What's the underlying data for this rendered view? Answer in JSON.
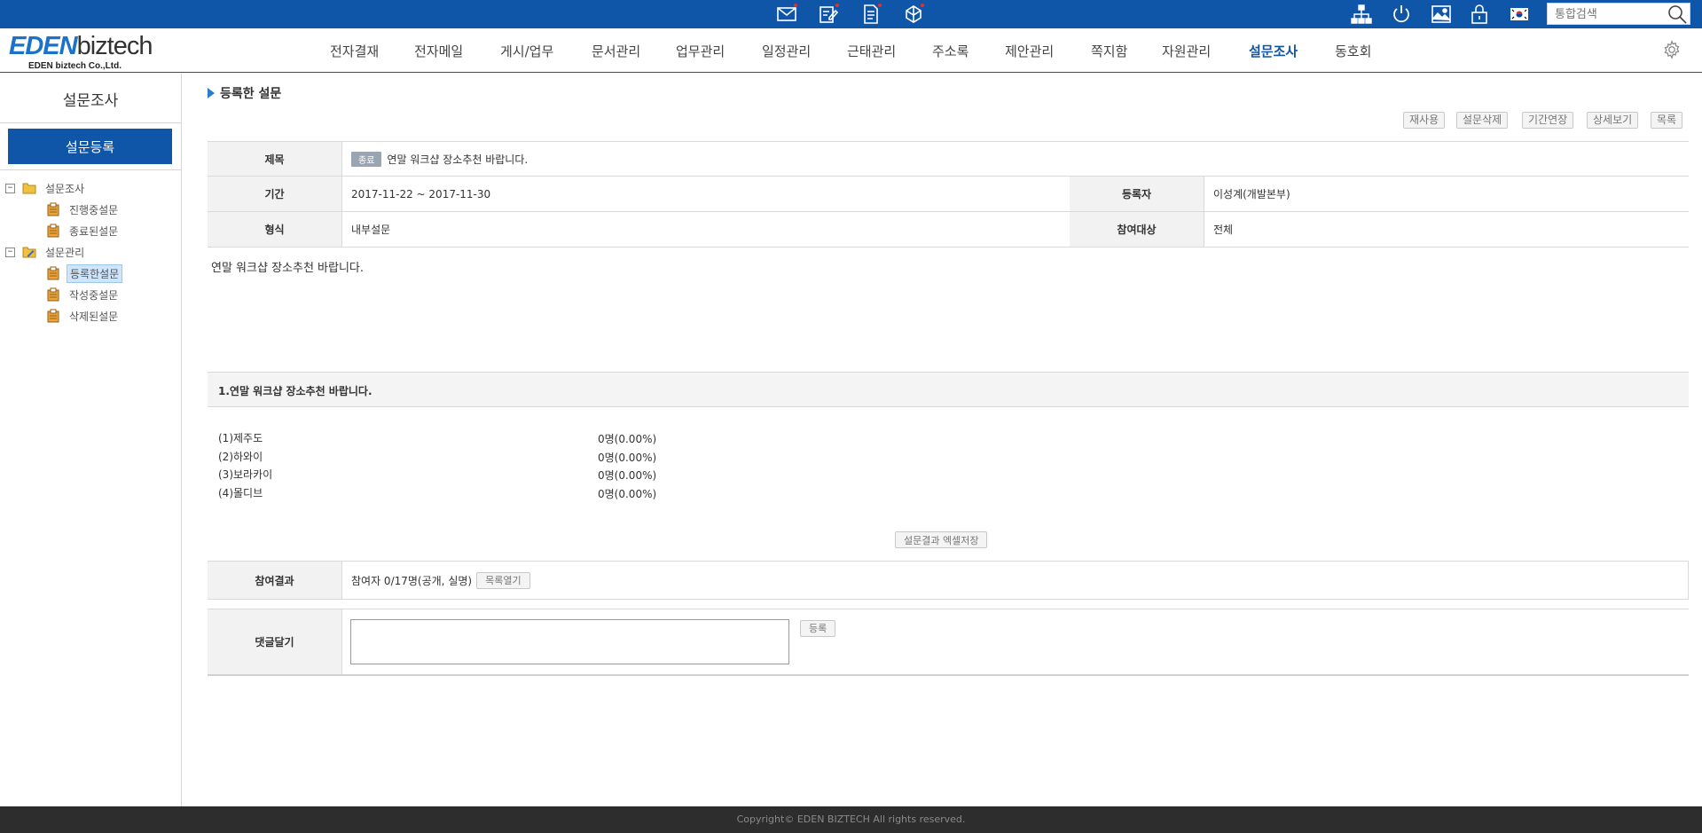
{
  "topbar": {
    "icons": [
      "mail-icon",
      "approval-icon",
      "document-icon",
      "notebook-icon",
      "org-chart-icon",
      "power-icon",
      "image-icon",
      "lock-icon",
      "korea-flag-icon"
    ],
    "search_placeholder": "통합검색",
    "accent": "#0f56a8"
  },
  "header": {
    "logo_brand_a": "EDEN",
    "logo_brand_b": "biztech",
    "logo_sub": "EDEN biztech Co.,Ltd.",
    "nav": [
      "전자결재",
      "전자메일",
      "게시/업무",
      "문서관리",
      "업무관리",
      "일정관리",
      "근태관리",
      "주소록",
      "제안관리",
      "쪽지함",
      "자원관리",
      "설문조사",
      "동호회"
    ],
    "active_nav": "설문조사"
  },
  "sidebar": {
    "title": "설문조사",
    "register_button": "설문등록",
    "tree": [
      {
        "label": "설문조사",
        "toggle": "−",
        "children": [
          "진행중설문",
          "종료된설문"
        ]
      },
      {
        "label": "설문관리",
        "toggle": "−",
        "children": [
          "등록한설문",
          "작성중설문",
          "삭제된설문"
        ]
      }
    ],
    "selected": "등록한설문"
  },
  "main": {
    "page_title": "등록한 설문",
    "actions": [
      "재사용",
      "설문삭제",
      "기간연장",
      "상세보기",
      "목록"
    ],
    "info": {
      "title_label": "제목",
      "status_badge": "종료",
      "title_value": "연말 워크샵 장소추천 바랍니다.",
      "period_label": "기간",
      "period_value": "2017-11-22 ~ 2017-11-30",
      "author_label": "등록자",
      "author_value": "이성계(개발본부)",
      "type_label": "형식",
      "type_value": "내부설문",
      "target_label": "참여대상",
      "target_value": "전체"
    },
    "description": "연말 워크샵 장소추천 바랍니다.",
    "question": {
      "title": "1.연말 워크샵 장소추천 바랍니다.",
      "options": [
        {
          "label": "(1)제주도",
          "result": "0명(0.00%)"
        },
        {
          "label": "(2)하와이",
          "result": "0명(0.00%)"
        },
        {
          "label": "(3)보라카이",
          "result": "0명(0.00%)"
        },
        {
          "label": "(4)몰디브",
          "result": "0명(0.00%)"
        }
      ]
    },
    "excel_button": "설문결과 엑셀저장",
    "participation_label": "참여결과",
    "participation_value": "참여자 0/17명(공개, 실명)",
    "list_open_button": "목록열기",
    "comment_label": "댓글달기",
    "comment_value": "",
    "comment_submit": "등록"
  },
  "footer": {
    "copyright": "Copyright© EDEN BIZTECH All rights reserved."
  }
}
